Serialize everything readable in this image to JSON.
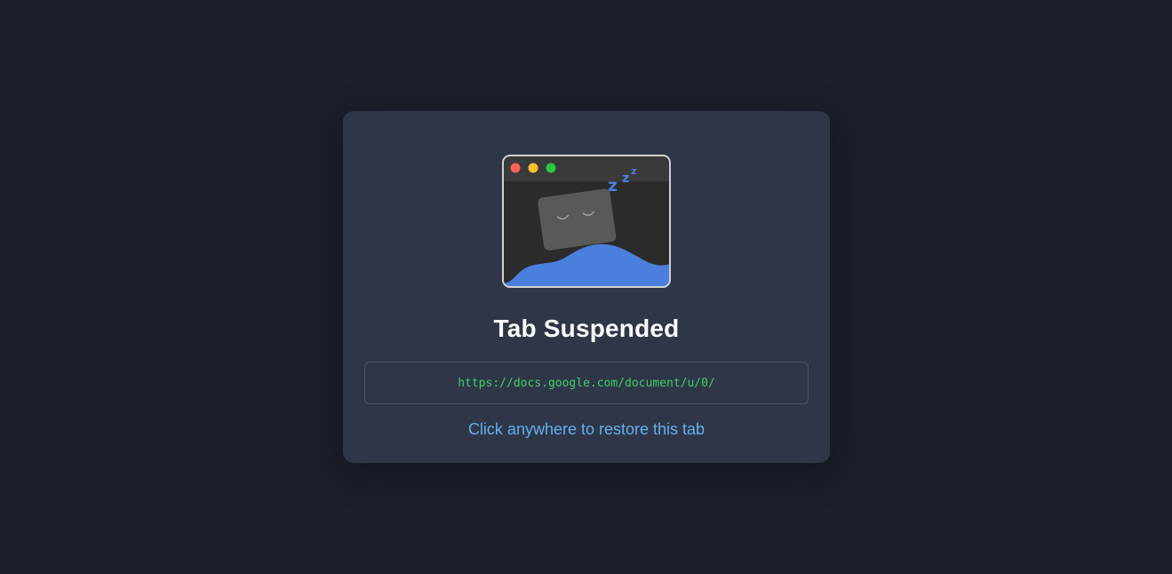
{
  "page": {
    "title": "Tab Suspended",
    "url": "https://docs.google.com/document/u/0/",
    "restore_hint": "Click anywhere to restore this tab"
  },
  "illustration": {
    "icon": "sleeping-tab-icon",
    "sleep_text": "zzz",
    "window_dots": [
      "close-dot",
      "minimize-dot",
      "maximize-dot"
    ]
  },
  "colors": {
    "page_background": "#1b1f2a",
    "card_background": "#2e3647",
    "url_text": "#3ed06a",
    "restore_hint": "#63b0f0",
    "wave": "#4a7fdd",
    "dot_red": "#ff6058",
    "dot_yellow": "#ffbd2e",
    "dot_green": "#28c840"
  }
}
